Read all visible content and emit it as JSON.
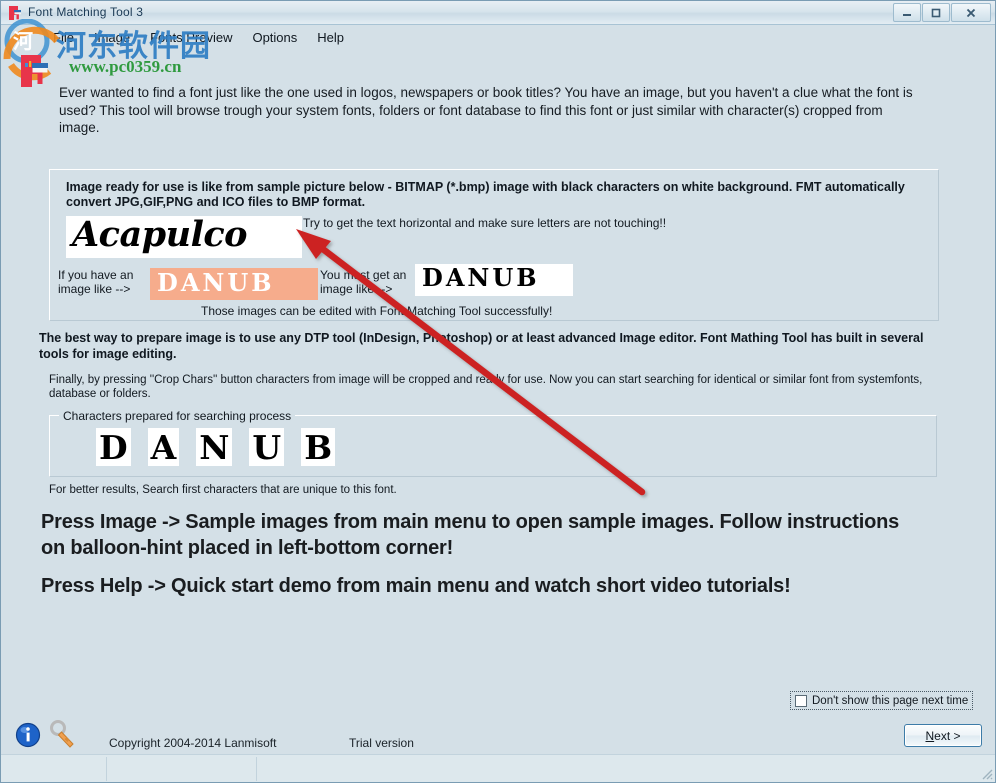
{
  "window": {
    "title": "Font Matching Tool 3",
    "icon": "app-icon",
    "minimize": "—",
    "maximize": "❐",
    "close": "✕"
  },
  "menu": {
    "items": [
      {
        "label": "File"
      },
      {
        "label": "Image"
      },
      {
        "label": "Fonts Preview"
      },
      {
        "label": "Options"
      },
      {
        "label": "Help"
      }
    ]
  },
  "watermark": {
    "chinese": "河东软件园",
    "url": "www.pc0359.cn"
  },
  "intro": {
    "text": "Ever wanted to find a font just like the one used in logos, newspapers or book titles? You have an image, but you haven't a clue what the font is used? This tool will browse trough your system fonts, folders or font database to find this font or just similar with character(s) cropped from image."
  },
  "sample_panel": {
    "note": "Image ready for use is like from sample picture below - BITMAP (*.bmp) image with  black characters on white background. FMT automatically convert JPG,GIF,PNG and ICO files to BMP format.",
    "acapulco_image_text": "Acapulco",
    "hint_horizontal": "Try to get the text horizontal and make sure letters are not touching!!",
    "label_if_you_have": "If you have an image like -->",
    "danub_salmon_text": "DANUB",
    "danub_salmon_bg": "#f6ac8c",
    "label_you_must_get": "You must get an image like -->",
    "danub_bw_text": "DANUB",
    "hint_editable": "Those images can be edited with Font Matching Tool successfully!"
  },
  "body": {
    "best_way": "The best way to prepare image is to use any DTP tool (InDesign, Photoshop) or at least advanced Image editor. Font Mathing Tool has built in several tools for image editing.",
    "finally_note": "Finally, by pressing ''Crop Chars'' button characters from image will be cropped and ready for use. Now you can start searching for identical or similar font from systemfonts, database or folders.",
    "better_results": "For better results, Search first characters that are unique to this font.",
    "cta_1": "Press Image -> Sample images from main menu to open sample images. Follow instructions on balloon-hint placed in left-bottom corner!",
    "cta_2": "Press Help -> Quick start demo from main menu and watch short video tutorials!"
  },
  "chars_panel": {
    "legend": "Characters prepared for searching process",
    "characters": [
      "D",
      "A",
      "N",
      "U",
      "B"
    ]
  },
  "footer": {
    "dont_show_label": "Don't show this page next time",
    "dont_show_checked": false,
    "next_label_prefix": "",
    "next_label_accel": "N",
    "next_label_suffix": "ext >",
    "copyright": "Copyright 2004-2014 Lanmisoft",
    "trial": "Trial version",
    "info_icon": "info-icon",
    "key_icon": "key-icon"
  },
  "colors": {
    "background": "#d4e0e7",
    "arrow": "#cc2222",
    "accent_blue": "#2f7ec4",
    "watermark_green": "#2f9a3f"
  }
}
